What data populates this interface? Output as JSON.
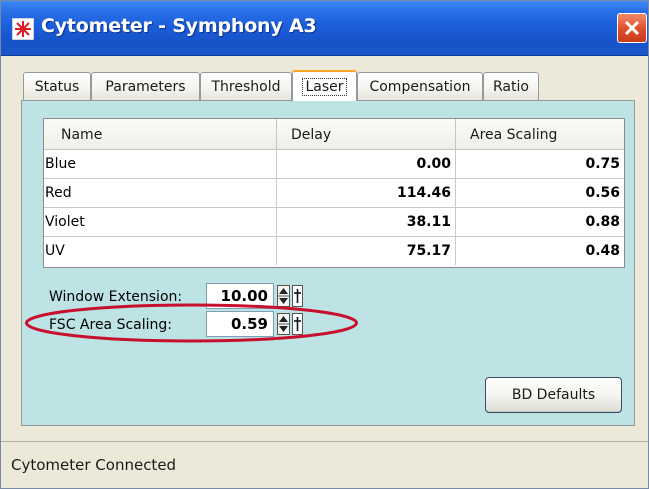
{
  "window": {
    "title": "Cytometer - Symphony A3",
    "colors": {
      "title_bar": "#1c5fdd",
      "panel": "#bde3e4",
      "close_button": "#e0522e",
      "highlight": "#c8102e"
    }
  },
  "tabs": [
    {
      "label": "Status",
      "active": false
    },
    {
      "label": "Parameters",
      "active": false
    },
    {
      "label": "Threshold",
      "active": false
    },
    {
      "label": "Laser",
      "active": true
    },
    {
      "label": "Compensation",
      "active": false
    },
    {
      "label": "Ratio",
      "active": false
    }
  ],
  "laser_table": {
    "columns": [
      "Name",
      "Delay",
      "Area Scaling"
    ],
    "rows": [
      {
        "name": "Blue",
        "delay": "0.00",
        "area_scaling": "0.75"
      },
      {
        "name": "Red",
        "delay": "114.46",
        "area_scaling": "0.56"
      },
      {
        "name": "Violet",
        "delay": "38.11",
        "area_scaling": "0.88"
      },
      {
        "name": "UV",
        "delay": "75.17",
        "area_scaling": "0.48"
      }
    ]
  },
  "window_extension": {
    "label": "Window Extension:",
    "value": "10.00"
  },
  "fsc_area_scaling": {
    "label": "FSC Area Scaling:",
    "value": "0.59"
  },
  "buttons": {
    "bd_defaults": "BD Defaults"
  },
  "status_bar": {
    "text": "Cytometer Connected"
  },
  "icons": [
    "cytometer-app-icon",
    "close-icon",
    "spin-arrows-icon",
    "lock-icon"
  ]
}
